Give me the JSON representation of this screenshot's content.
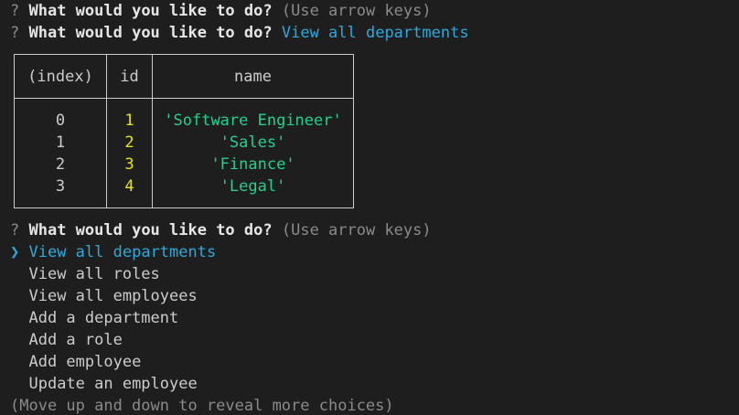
{
  "prompt": {
    "question_mark": "?",
    "question": "What would you like to do?",
    "hint": "(Use arrow keys)",
    "answered": "View all departments"
  },
  "table": {
    "headers": [
      "(index)",
      "id",
      "name"
    ],
    "rows": [
      {
        "index": "0",
        "id": "1",
        "name": "'Software Engineer'"
      },
      {
        "index": "1",
        "id": "2",
        "name": "'Sales'"
      },
      {
        "index": "2",
        "id": "3",
        "name": "'Finance'"
      },
      {
        "index": "3",
        "id": "4",
        "name": "'Legal'"
      }
    ]
  },
  "menu": {
    "pointer": "❯",
    "choices": [
      "View all departments",
      "View all roles",
      "View all employees",
      "Add a department",
      "Add a role",
      "Add employee",
      "Update an employee"
    ],
    "selected_index": 0,
    "footer": "(Move up and down to reveal more choices)"
  },
  "colors": {
    "background": "#1e1e1e",
    "answer": "#2fa8dc",
    "id_values": "#e5e510",
    "name_values": "#23d18b"
  }
}
